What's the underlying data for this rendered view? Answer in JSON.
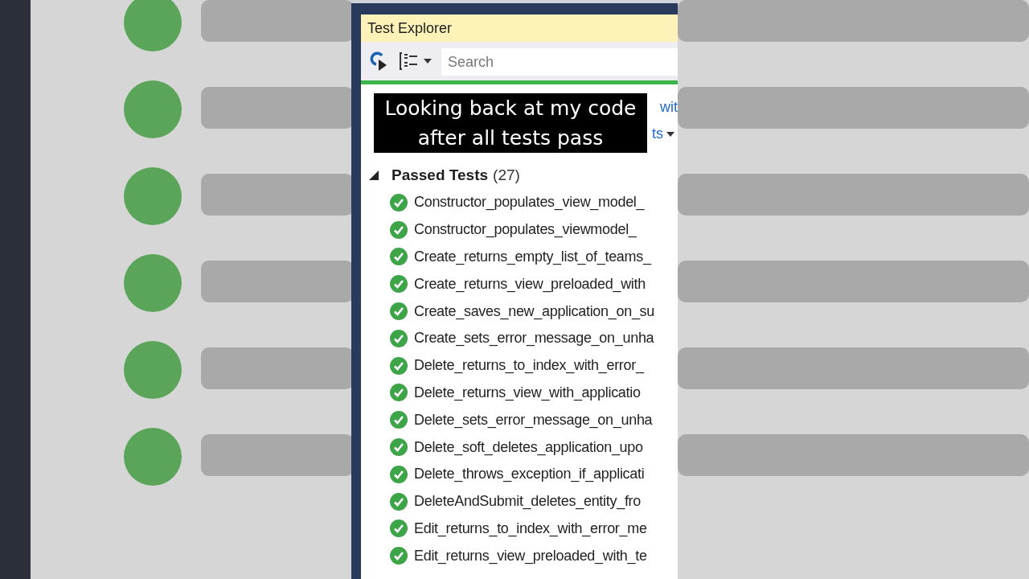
{
  "window": {
    "title": "Test Explorer"
  },
  "progress": {
    "level": 1
  },
  "toolbar": {
    "search": {
      "placeholder": "Search"
    }
  },
  "caption": "Looking back at my code after all tests pass",
  "summary": {
    "link": "wit",
    "menu": "ts"
  },
  "group": {
    "label": "Passed Tests",
    "count": "(27)",
    "expanded": true
  },
  "tests": [
    {
      "name": "Constructor_populates_view_model_",
      "kind": "passed"
    },
    {
      "name": "Constructor_populates_viewmodel_",
      "kind": "passed"
    },
    {
      "name": "Create_returns_empty_list_of_teams_",
      "kind": "passed"
    },
    {
      "name": "Create_returns_view_preloaded_with",
      "kind": "passed"
    },
    {
      "name": "Create_saves_new_application_on_su",
      "kind": "passed"
    },
    {
      "name": "Create_sets_error_message_on_unha",
      "kind": "passed"
    },
    {
      "name": "Delete_returns_to_index_with_error_",
      "kind": "passed"
    },
    {
      "name": "Delete_returns_view_with_applicatio",
      "kind": "passed"
    },
    {
      "name": "Delete_sets_error_message_on_unha",
      "kind": "passed"
    },
    {
      "name": "Delete_soft_deletes_application_upo",
      "kind": "passed"
    },
    {
      "name": "Delete_throws_exception_if_applicati",
      "kind": "passed"
    },
    {
      "name": "DeleteAndSubmit_deletes_entity_fro",
      "kind": "passed"
    },
    {
      "name": "Edit_returns_to_index_with_error_me",
      "kind": "passed"
    },
    {
      "name": "Edit_returns_view_preloaded_with_te",
      "kind": "passed"
    }
  ]
}
